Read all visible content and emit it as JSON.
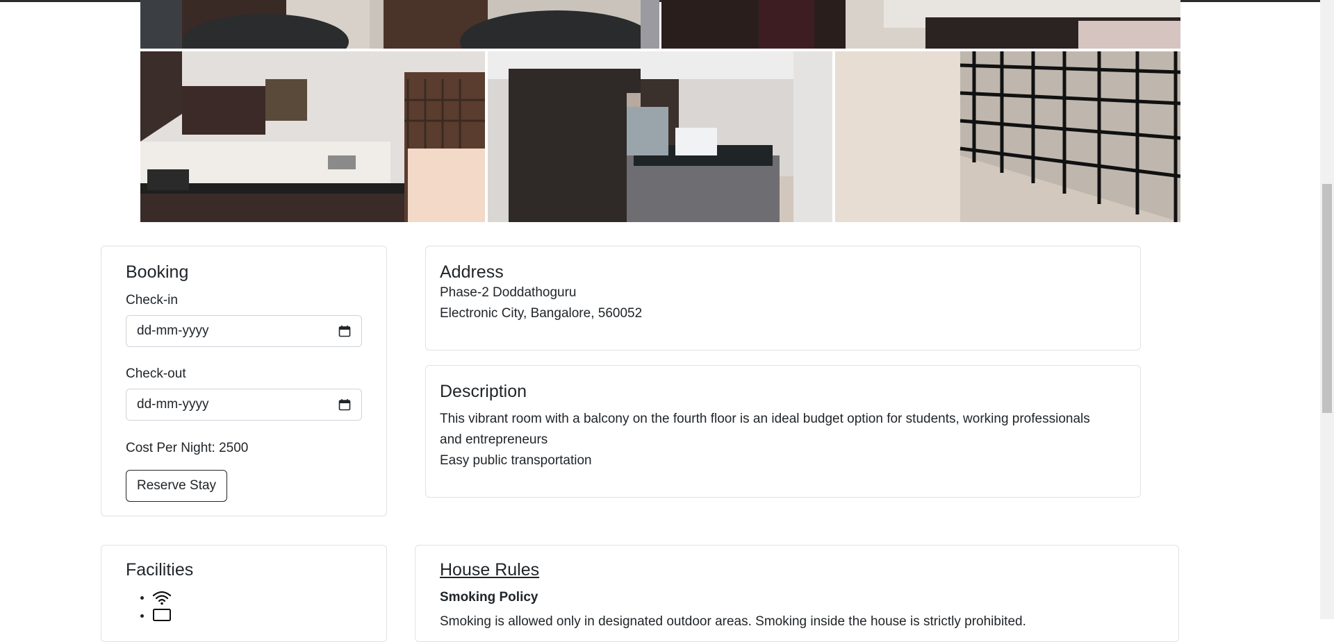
{
  "booking": {
    "title": "Booking",
    "checkin_label": "Check-in",
    "checkin_placeholder": "dd-mm-yyyy",
    "checkout_label": "Check-out",
    "checkout_placeholder": "dd-mm-yyyy",
    "cost_label": "Cost Per Night: 2500",
    "reserve_label": "Reserve Stay"
  },
  "address": {
    "title": "Address",
    "line1": "Phase-2 Doddathoguru",
    "line2": "Electronic City, Bangalore, 560052"
  },
  "description": {
    "title": "Description",
    "line1": "This vibrant room with a balcony on the fourth floor is an ideal budget option for students, working professionals and entrepreneurs",
    "line2": "Easy public transportation"
  },
  "facilities": {
    "title": "Facilities",
    "items": [
      {
        "icon": "wifi-icon"
      },
      {
        "icon": "tv-icon"
      }
    ]
  },
  "rules": {
    "title": "House Rules",
    "smoking_title": "Smoking Policy",
    "smoking_text": "Smoking is allowed only in designated outdoor areas. Smoking inside the house is strictly prohibited."
  },
  "colors": {
    "text": "#212529",
    "border": "#dee2e6"
  }
}
